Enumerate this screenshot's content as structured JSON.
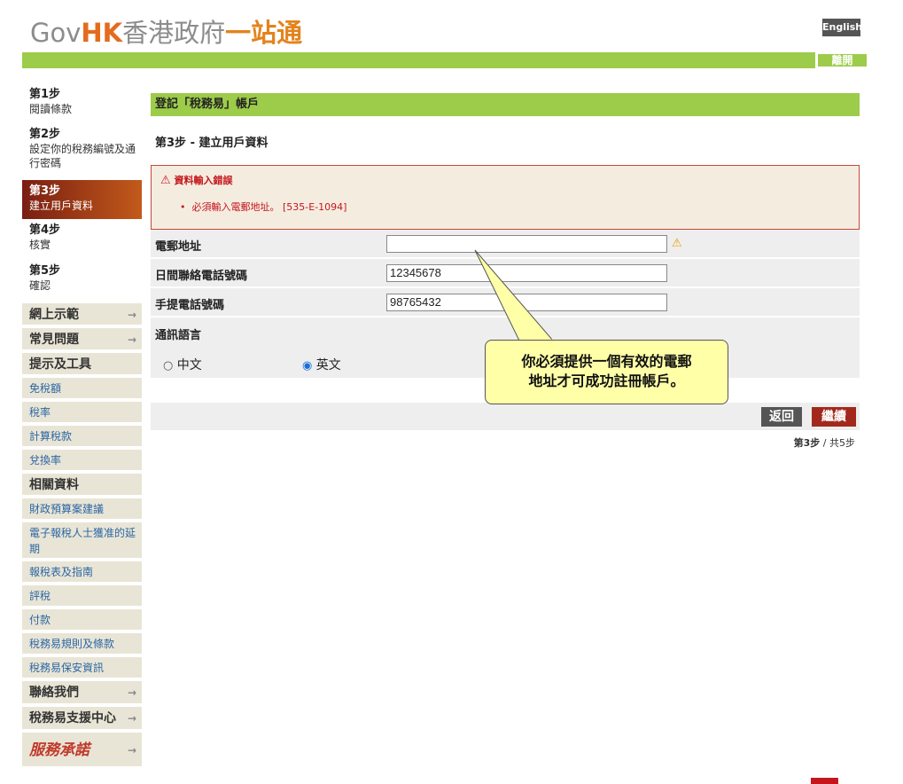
{
  "header": {
    "logo_gov": "Gov",
    "logo_hk": "HK",
    "logo_zh_1": "香港政府",
    "logo_zh_2": "一站通",
    "language_button": "English",
    "exit_button": "離開"
  },
  "sidebar": {
    "steps": [
      {
        "num": "第1步",
        "desc": "閱讀條款"
      },
      {
        "num": "第2步",
        "desc": "設定你的稅務編號及通行密碼"
      },
      {
        "num": "第3步",
        "desc": "建立用戶資料"
      },
      {
        "num": "第4步",
        "desc": "核實"
      },
      {
        "num": "第5步",
        "desc": "確認"
      }
    ],
    "nav": {
      "demo": "網上示範",
      "faq": "常見問題",
      "tips": "提示及工具",
      "allowances": "免稅額",
      "tax_rates": "稅率",
      "calc": "計算稅款",
      "exchange": "兌換率",
      "related": "相關資料",
      "budget": "財政預算案建議",
      "extension": "電子報稅人士獲准的延期",
      "returns": "報稅表及指南",
      "assessment": "評稅",
      "payment": "付款",
      "rules": "稅務易規則及條款",
      "security": "稅務易保安資訊",
      "contact": "聯絡我們",
      "support": "稅務易支援中心",
      "pledge": "服務承諾",
      "arrow": "→"
    }
  },
  "main": {
    "title": "登記「稅務易」帳戶",
    "step_title": "第3步 - 建立用戶資料",
    "error": {
      "title": "資料輸入錯誤",
      "message": "必須輸入電郵地址。 [535-E-1094]"
    },
    "form": {
      "email_label": "電郵地址",
      "email_value": "",
      "day_phone_label": "日間聯絡電話號碼",
      "day_phone_value": "12345678",
      "mobile_label": "手提電話號碼",
      "mobile_value": "98765432",
      "language_label": "通訊語言",
      "lang_option_zh": "中文",
      "lang_option_en": "英文",
      "selected_language": "英文"
    },
    "back_button": "返回",
    "continue_button": "繼續",
    "pager_bold": "第3步",
    "pager_rest": " / 共5步"
  },
  "callout": {
    "line1": "你必須提供一個有效的電郵",
    "line2": "地址才可成功註冊帳戶。"
  },
  "colors": {
    "green": "#9dcb4a",
    "active_step": "#a0361a",
    "error": "#c4161c",
    "continue": "#a3281c",
    "back": "#555555"
  }
}
